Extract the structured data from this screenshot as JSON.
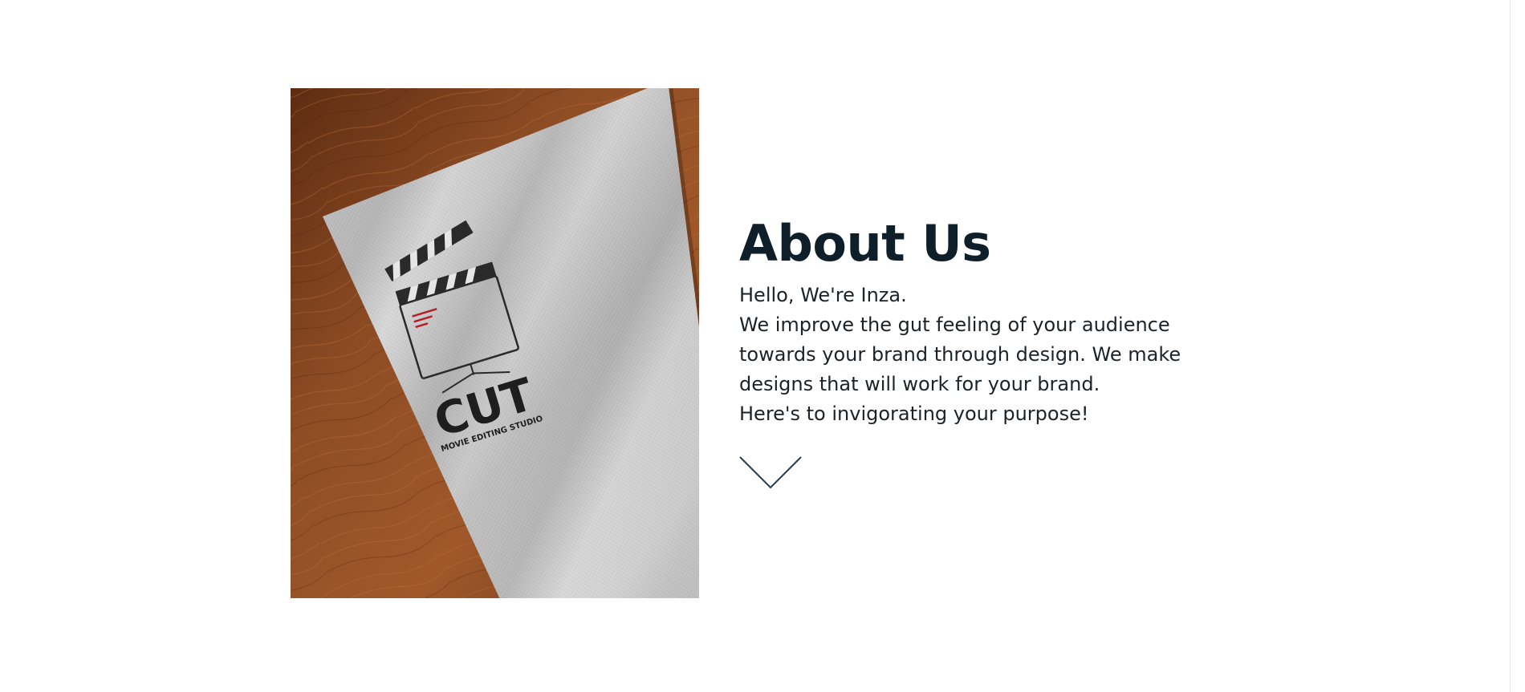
{
  "about": {
    "heading": "About Us",
    "greeting": "Hello, We're Inza.",
    "description": "We improve the gut feeling of your audience towards your brand through design. We make designs that will work for your brand.",
    "tagline": "Here's to invigorating your purpose!"
  },
  "photo": {
    "logo_word": "CUT",
    "logo_subtitle": "MOVIE EDITING STUDIO"
  },
  "scroll_icon": "chevron-down-icon",
  "colors": {
    "heading": "#0e1f2a",
    "body_text": "#1b2329",
    "chevron": "#2b3b47",
    "logo_accent": "#b3202a",
    "wood": "#8a4a22"
  }
}
